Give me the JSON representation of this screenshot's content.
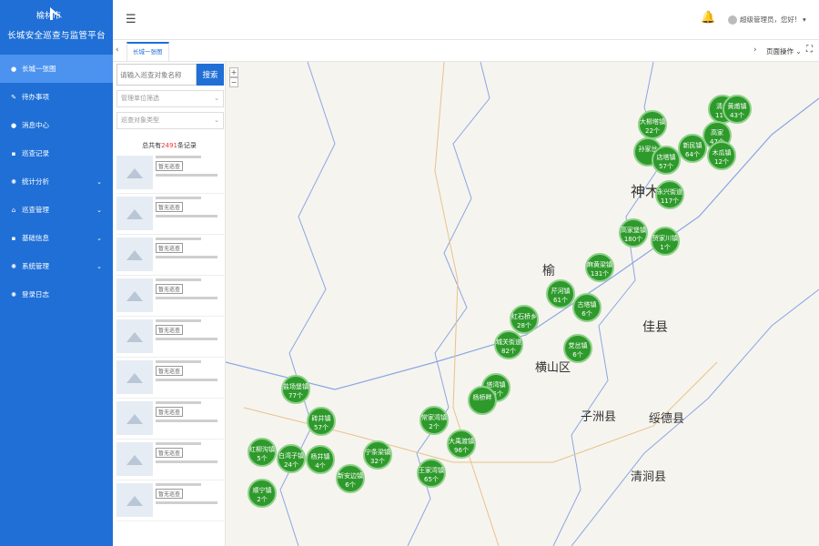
{
  "app": {
    "city": "榆林市",
    "title": "长城安全巡查与监管平台"
  },
  "menu": [
    {
      "label": "长城一张图",
      "icon": "pin-icon"
    },
    {
      "label": "待办事项",
      "icon": "wrench-icon"
    },
    {
      "label": "消息中心",
      "icon": "bell-icon"
    },
    {
      "label": "巡查记录",
      "icon": "calendar-icon"
    },
    {
      "label": "统计分析",
      "icon": "gear-icon"
    },
    {
      "label": "巡查管理",
      "icon": "home-icon"
    },
    {
      "label": "基础信息",
      "icon": "calendar-icon"
    },
    {
      "label": "系统管理",
      "icon": "gear-icon"
    },
    {
      "label": "登录日志",
      "icon": "gear-icon"
    }
  ],
  "header": {
    "user": "超级管理员，您好!"
  },
  "tabs": {
    "current": "长城一张图",
    "page_ops": "页面操作"
  },
  "filters": {
    "search_placeholder": "请输入巡查对象名称",
    "search_button": "搜索",
    "unit_placeholder": "管理单位筛选",
    "type_placeholder": "巡查对象类型"
  },
  "records": {
    "prefix": "总共有",
    "count": "2491",
    "suffix": "条记录",
    "badge": "暂无巡查"
  },
  "clusters": [
    {
      "name": "清水",
      "count": "11个"
    },
    {
      "name": "黄甫镇",
      "count": "43个"
    },
    {
      "name": "大柳塔镇",
      "count": "22个"
    },
    {
      "name": "新民镇",
      "count": "64个"
    },
    {
      "name": "高家",
      "count": "47个"
    },
    {
      "name": "木瓜镇",
      "count": "12个"
    },
    {
      "name": "孙家岔",
      "count": ""
    },
    {
      "name": "店塔镇",
      "count": "57个"
    },
    {
      "name": "永兴街道",
      "count": "117个"
    },
    {
      "name": "贺家川镇",
      "count": "1个"
    },
    {
      "name": "高家堡镇",
      "count": "180个"
    },
    {
      "name": "麻黄梁镇",
      "count": "131个"
    },
    {
      "name": "芹河镇",
      "count": "61个"
    },
    {
      "name": "古塔镇",
      "count": "6个"
    },
    {
      "name": "红石桥乡",
      "count": "28个"
    },
    {
      "name": "党岔镇",
      "count": "6个"
    },
    {
      "name": "城关街道",
      "count": "82个"
    },
    {
      "name": "塔湾镇",
      "count": "65个"
    },
    {
      "name": "杨桥畔",
      "count": ""
    },
    {
      "name": "常家湾镇",
      "count": "2个"
    },
    {
      "name": "大禹渡镇",
      "count": "96个"
    },
    {
      "name": "盐场堡镇",
      "count": "77个"
    },
    {
      "name": "砖井镇",
      "count": "57个"
    },
    {
      "name": "红柳沟镇",
      "count": "5个"
    },
    {
      "name": "白湾子镇",
      "count": "24个"
    },
    {
      "name": "杨井镇",
      "count": "4个"
    },
    {
      "name": "宁条梁镇",
      "count": "32个"
    },
    {
      "name": "新安边镇",
      "count": "6个"
    },
    {
      "name": "王家湾镇",
      "count": "65个"
    },
    {
      "name": "顺宁镇",
      "count": "2个"
    }
  ],
  "places": [
    "神木",
    "榆",
    "佳县",
    "横山区",
    "子洲县",
    "绥德县",
    "清涧县"
  ]
}
